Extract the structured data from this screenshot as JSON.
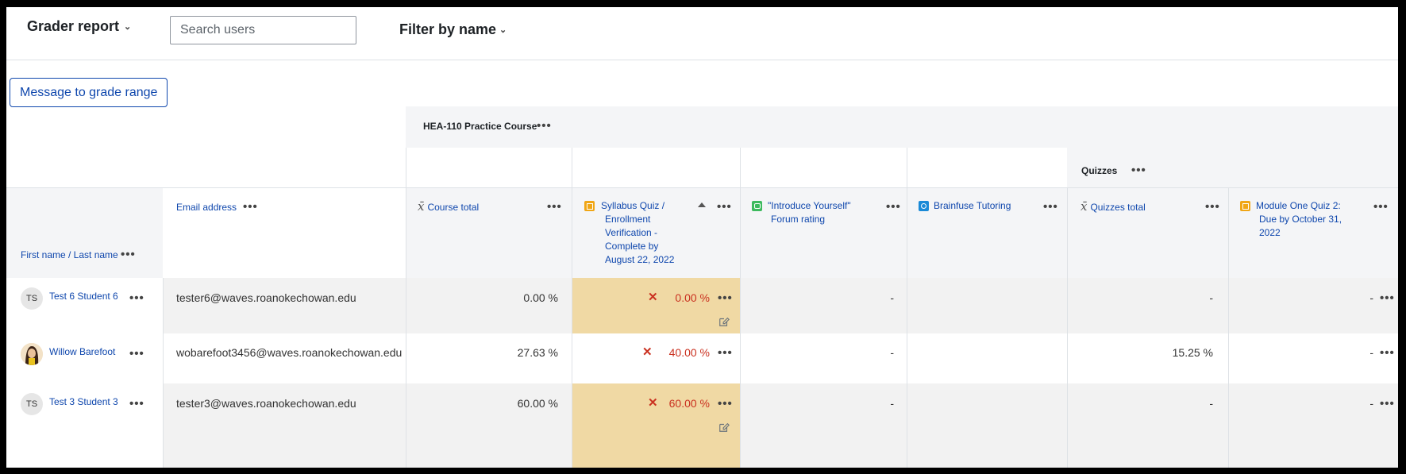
{
  "header": {
    "report_selector": "Grader report",
    "search_placeholder": "Search users",
    "filter_label": "Filter by name"
  },
  "message_button": "Message to grade range",
  "categories": {
    "course": "HEA-110 Practice Course",
    "quizzes": "Quizzes"
  },
  "columns": {
    "name": "First name / Last name",
    "email": "Email address",
    "course_total": "Course total",
    "syllabus_quiz": [
      "Syllabus Quiz /",
      "Enrollment",
      "Verification -",
      "Complete by",
      "August 22, 2022"
    ],
    "forum": [
      "\"Introduce Yourself\"",
      "Forum rating"
    ],
    "brainfuse": "Brainfuse Tutoring",
    "quizzes_total": "Quizzes total",
    "module_one": [
      "Module One Quiz 2:",
      "Due by October 31,",
      "2022"
    ]
  },
  "rows": [
    {
      "initials": "TS",
      "name": "Test 6 Student 6",
      "email": "tester6@waves.roanokechowan.edu",
      "course_total": "0.00 %",
      "syllabus": "0.00 %",
      "forum": "-",
      "brainfuse": "",
      "quizzes_total": "-",
      "module_one": "-"
    },
    {
      "initials": "",
      "name": "Willow Barefoot",
      "email": "wobarefoot3456@waves.roanokechowan.edu",
      "course_total": "27.63 %",
      "syllabus": "40.00 %",
      "forum": "-",
      "brainfuse": "",
      "quizzes_total": "15.25 %",
      "module_one": "-"
    },
    {
      "initials": "TS",
      "name": "Test 3 Student 3",
      "email": "tester3@waves.roanokechowan.edu",
      "course_total": "60.00 %",
      "syllabus": "60.00 %",
      "forum": "-",
      "brainfuse": "",
      "quizzes_total": "-",
      "module_one": "-"
    }
  ],
  "glyphs": {
    "dots": "•••",
    "fail": "✕",
    "chevron": "⌄"
  }
}
